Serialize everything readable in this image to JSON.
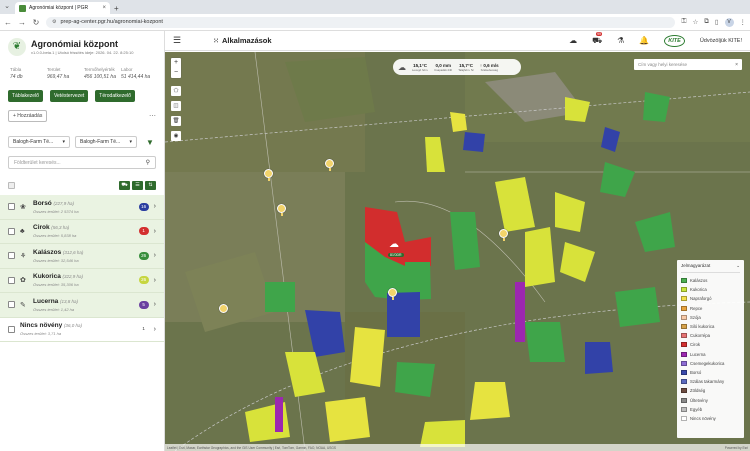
{
  "browser": {
    "tab_title": "Agronómiai központ | PGR",
    "url": "prep-ag-center.pgr.hu/agronomiai-kozpont",
    "avatar": "V"
  },
  "brand": {
    "name": "Agronómiai központ",
    "version": "v1.0.0-beta.1 | Utolsó frissítés ideje: 2026. 04. 22. 8:25:10"
  },
  "stats": [
    {
      "label": "Tábla",
      "value": "74 db"
    },
    {
      "label": "Terület",
      "value": "969,47 ha"
    },
    {
      "label": "Termőhelyérték",
      "value": "456 100,51 ha"
    },
    {
      "label": "Labor",
      "value": "51 414,44 ha"
    }
  ],
  "actions": {
    "fields": "Táblakezelő",
    "crop_planner": "Vetéstervezet",
    "soil": "Térodatkezelő",
    "add": "+ Hozzáadás"
  },
  "filters": {
    "farm1": "Balogh-Farm Té...",
    "farm2": "Balogh-Farm Té...",
    "search_placeholder": "Földterület keresés..."
  },
  "crops": [
    {
      "name": "Borsó",
      "area": "(227,9 ha)",
      "total": "Összes terület: 2 5374 ha",
      "count": "16",
      "color": "#2b3ea0",
      "icon": "❀"
    },
    {
      "name": "Cirok",
      "area": "(56,3 ha)",
      "total": "Összes terület: 5,838 ha",
      "count": "1",
      "color": "#d32f2f",
      "icon": "♣"
    },
    {
      "name": "Kalászos",
      "area": "(312,6 ha)",
      "total": "Összes terület: 32,546 ha",
      "count": "26",
      "color": "#388e3c",
      "icon": "⚘"
    },
    {
      "name": "Kukorica",
      "area": "(322,9 ha)",
      "total": "Összes terület: 35,306 ha",
      "count": "26",
      "color": "#c6d640",
      "icon": "✿"
    },
    {
      "name": "Lucerna",
      "area": "(13,8 ha)",
      "total": "Összes terület: 1,42 ha",
      "count": "5",
      "color": "#6a3fa0",
      "icon": "✎"
    },
    {
      "name": "Nincs növény",
      "area": "(36,0 ha)",
      "total": "Összes terület: 3,71 ha",
      "count": "1",
      "color": "#ffffff",
      "icon": ""
    }
  ],
  "header": {
    "apps_label": "Alkalmazások",
    "notif_count": "99",
    "kite_logo": "KITE",
    "welcome": "Üdvözöljük KITE!"
  },
  "weather": [
    {
      "value": "15,1°C",
      "label": "Levegő hőm."
    },
    {
      "value": "0,0 mm",
      "label": "Csapadék 24h"
    },
    {
      "value": "15,7°C",
      "label": "Talajhőm. 5c"
    },
    {
      "value": "↑ 0,6 m/s",
      "label": "Szélsebesség"
    }
  ],
  "map": {
    "address_placeholder": "Cím vagy helyi keresése",
    "attribution_left": "Leaflet | Esri, Maxar, Earthstar Geographics, and the GIS User Community | Esri, TomTom, Garmin, FAO, NOAA, USGS",
    "attribution_right": "Powered by Esri",
    "center_label": "81'0DR"
  },
  "legend": {
    "title": "Jelmagyarázat",
    "items": [
      {
        "label": "Kalászos",
        "color": "#4caf50"
      },
      {
        "label": "Kukorica",
        "color": "#c8e63c"
      },
      {
        "label": "Napraforgó",
        "color": "#f3e04a"
      },
      {
        "label": "Repce",
        "color": "#e8a33c"
      },
      {
        "label": "Szója",
        "color": "#f7c9a6"
      },
      {
        "label": "Siló kukorica",
        "color": "#d6a24a"
      },
      {
        "label": "Cukorrépa",
        "color": "#e57373"
      },
      {
        "label": "Cirok",
        "color": "#d32f2f"
      },
      {
        "label": "Lucerna",
        "color": "#9c27b0"
      },
      {
        "label": "Csemegekukorica",
        "color": "#8d6bd4"
      },
      {
        "label": "Borsó",
        "color": "#3949ab"
      },
      {
        "label": "Szálas takarmány",
        "color": "#5c6bc0"
      },
      {
        "label": "Zöldség",
        "color": "#6d4c41"
      },
      {
        "label": "Ültetvény",
        "color": "#888888"
      },
      {
        "label": "Egyéb",
        "color": "#bdbdbd"
      },
      {
        "label": "Nincs növény",
        "color": "#ffffff"
      }
    ]
  }
}
